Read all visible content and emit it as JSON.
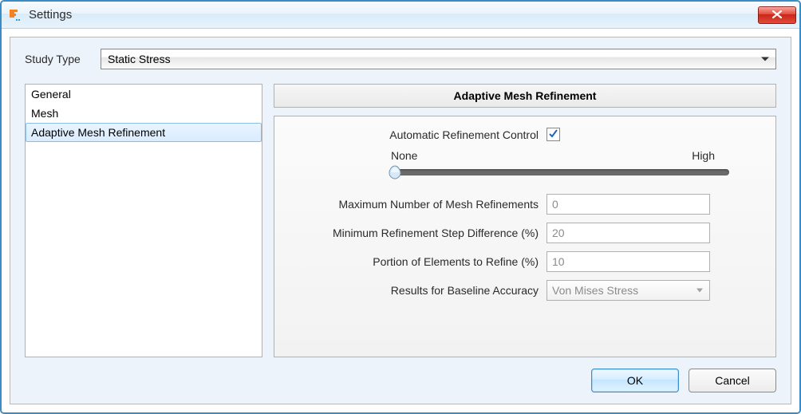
{
  "window": {
    "title": "Settings"
  },
  "studyType": {
    "label": "Study Type",
    "value": "Static Stress"
  },
  "sidebar": {
    "items": [
      {
        "label": "General",
        "selected": false
      },
      {
        "label": "Mesh",
        "selected": false
      },
      {
        "label": "Adaptive Mesh Refinement",
        "selected": true
      }
    ]
  },
  "panel": {
    "title": "Adaptive Mesh Refinement",
    "autoRefine": {
      "label": "Automatic Refinement Control",
      "checked": true
    },
    "slider": {
      "leftLabel": "None",
      "rightLabel": "High",
      "value": 0,
      "min": 0,
      "max": 100
    },
    "fields": {
      "maxRefinements": {
        "label": "Maximum Number of Mesh Refinements",
        "value": "0"
      },
      "minStepDiff": {
        "label": "Minimum Refinement Step Difference (%)",
        "value": "20"
      },
      "portionRefine": {
        "label": "Portion of Elements to Refine (%)",
        "value": "10"
      },
      "baselineAcc": {
        "label": "Results for Baseline Accuracy",
        "value": "Von Mises Stress"
      }
    }
  },
  "buttons": {
    "ok": "OK",
    "cancel": "Cancel"
  }
}
